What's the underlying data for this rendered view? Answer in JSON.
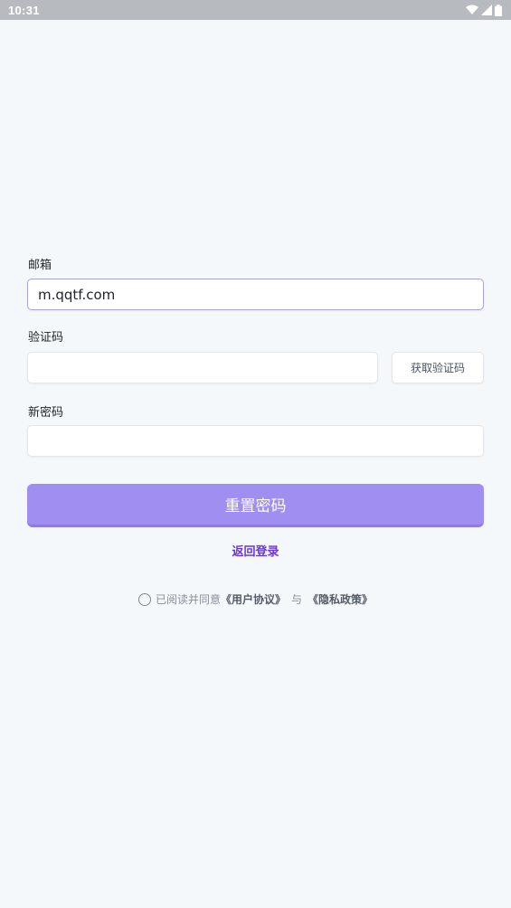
{
  "status_bar": {
    "time": "10:31",
    "icons": [
      "wifi-icon",
      "cell-signal-icon",
      "battery-icon"
    ]
  },
  "form": {
    "email": {
      "label": "邮箱",
      "value": "m.qqtf.com"
    },
    "code": {
      "label": "验证码",
      "value": "",
      "send_button": "获取验证码"
    },
    "new_password": {
      "label": "新密码",
      "value": ""
    },
    "submit_label": "重置密码",
    "back_link": "返回登录"
  },
  "agreement": {
    "checked": false,
    "prefix": "已阅读并同意",
    "user_agreement": "《用户协议》",
    "separator": "与",
    "privacy_policy": "《隐私政策》"
  },
  "colors": {
    "primary_button": "#a08ef0",
    "link": "#6a38d4",
    "status_bar_bg": "#b7bbbf",
    "page_bg": "#f5f8fb"
  }
}
